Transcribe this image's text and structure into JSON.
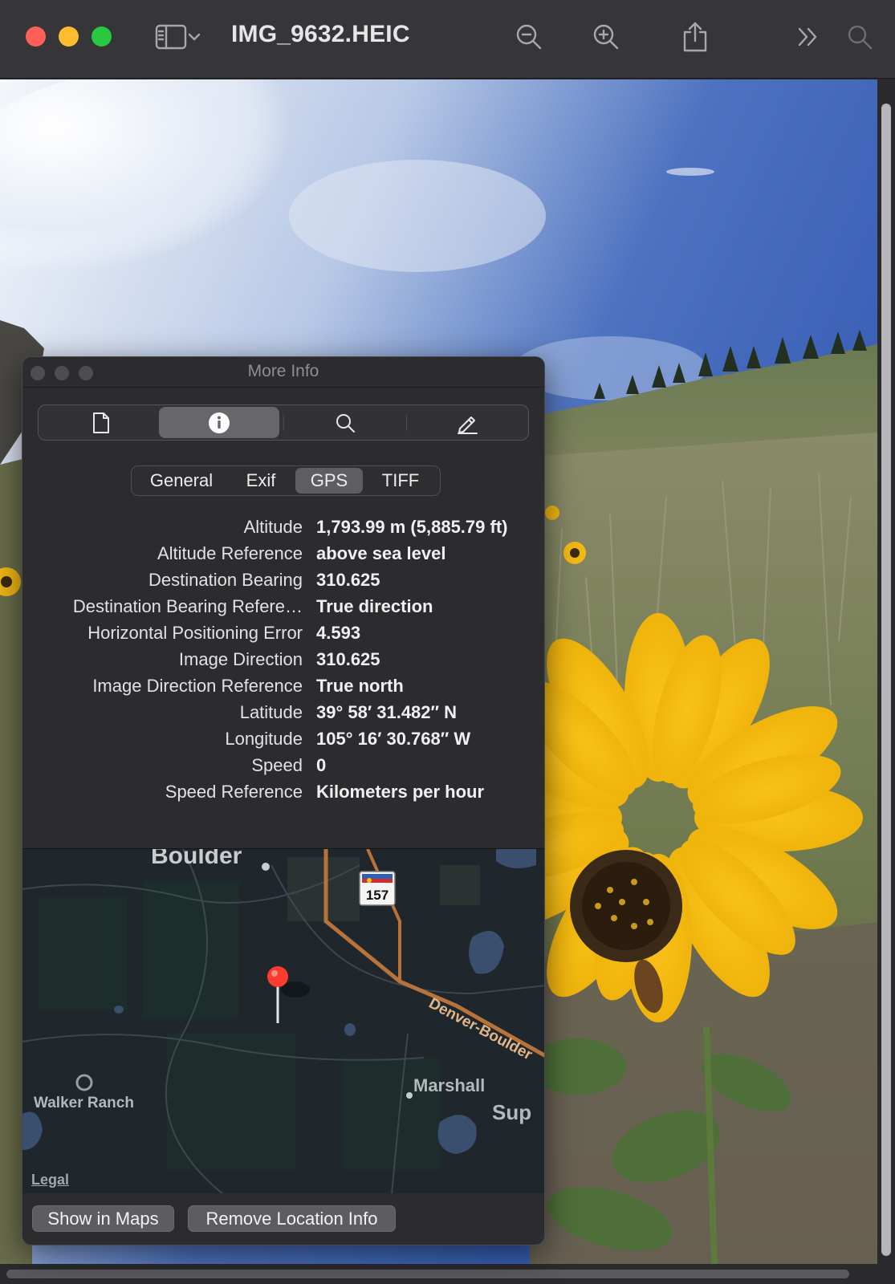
{
  "window": {
    "title": "IMG_9632.HEIC"
  },
  "toolbar": {
    "icons": [
      "sidebar-toggle-icon",
      "chevron-down-icon",
      "zoom-out-icon",
      "zoom-in-icon",
      "share-icon",
      "overflow-chevron-icon",
      "search-icon"
    ]
  },
  "panel": {
    "title": "More Info",
    "segments": [
      "document-icon",
      "info-icon",
      "search-icon",
      "pencil-icon"
    ],
    "active_segment": "info-icon",
    "tabs": [
      {
        "label": "General"
      },
      {
        "label": "Exif"
      },
      {
        "label": "GPS"
      },
      {
        "label": "TIFF"
      }
    ],
    "active_tab": "GPS",
    "rows": [
      {
        "label": "Altitude",
        "value": "1,793.99 m (5,885.79 ft)"
      },
      {
        "label": "Altitude Reference",
        "value": "above sea level"
      },
      {
        "label": "Destination Bearing",
        "value": "310.625"
      },
      {
        "label": "Destination Bearing Refere…",
        "value": "True direction"
      },
      {
        "label": "Horizontal Positioning Error",
        "value": "4.593"
      },
      {
        "label": "Image Direction",
        "value": "310.625"
      },
      {
        "label": "Image Direction Reference",
        "value": "True north"
      },
      {
        "label": "Latitude",
        "value": "39° 58′ 31.482″ N"
      },
      {
        "label": "Longitude",
        "value": "105° 16′ 30.768″ W"
      },
      {
        "label": "Speed",
        "value": "0"
      },
      {
        "label": "Speed Reference",
        "value": "Kilometers per hour"
      }
    ],
    "map": {
      "labels": {
        "city": "Boulder",
        "highway_shield": "157",
        "road": "Denver-Boulder",
        "town": "Marshall",
        "town_partial": "Sup",
        "park": "Walker Ranch"
      },
      "legal": "Legal",
      "colors": {
        "land": "#1f262c",
        "road": "#b8733a",
        "water": "#3a4f6e",
        "pin": "#ff3b30"
      }
    },
    "buttons": {
      "show_in_maps": "Show in Maps",
      "remove_location": "Remove Location Info"
    }
  },
  "colors": {
    "traffic_red": "#ff5f57",
    "traffic_yellow": "#febc2e",
    "traffic_green": "#28c840",
    "sunflower": "#f5c518"
  }
}
